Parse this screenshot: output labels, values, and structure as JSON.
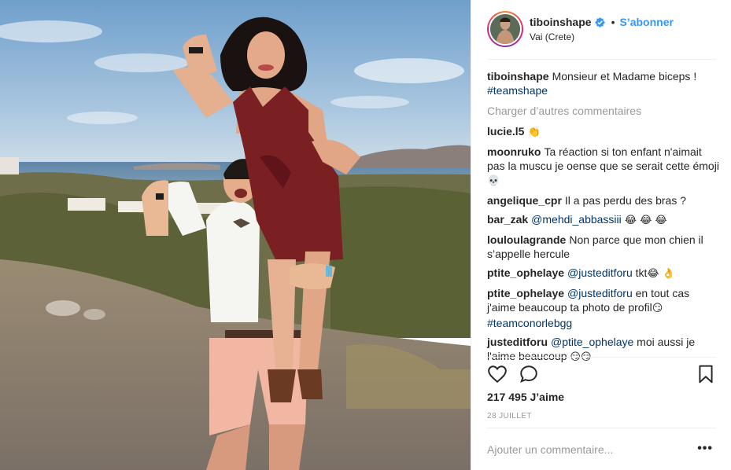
{
  "header": {
    "username": "tiboinshape",
    "follow_label": "S’abonner",
    "location": "Vai (Crete)"
  },
  "caption": {
    "user": "tiboinshape",
    "text": "Monsieur et Madame biceps !",
    "hashtag": "#teamshape"
  },
  "load_more": "Charger d’autres commentaires",
  "comments": [
    {
      "user": "lucie.l5",
      "parts": [
        {
          "t": "👏",
          "k": "emo"
        }
      ]
    },
    {
      "user": "moonruko",
      "parts": [
        {
          "t": "Ta réaction si ton enfant n'aimait pas la muscu je oense que se serait cette émoji ",
          "k": "txt"
        },
        {
          "t": "💀",
          "k": "emo"
        }
      ]
    },
    {
      "user": "angelique_cpr",
      "parts": [
        {
          "t": "Il a pas perdu des bras ?",
          "k": "txt"
        }
      ]
    },
    {
      "user": "bar_zak",
      "parts": [
        {
          "t": "@mehdi_abbassiii",
          "k": "tag"
        },
        {
          "t": " 😂 😂 😂",
          "k": "emo"
        }
      ]
    },
    {
      "user": "louloulagrande",
      "parts": [
        {
          "t": "Non parce que mon chien il s’appelle hercule",
          "k": "txt"
        }
      ]
    },
    {
      "user": "ptite_ophelaye",
      "parts": [
        {
          "t": "@justeditforu",
          "k": "tag"
        },
        {
          "t": " tkt",
          "k": "txt"
        },
        {
          "t": "😂 👌",
          "k": "emo"
        }
      ]
    },
    {
      "user": "ptite_ophelaye",
      "parts": [
        {
          "t": "@justeditforu",
          "k": "tag"
        },
        {
          "t": " en tout cas j'aime beaucoup ta photo de profil",
          "k": "txt"
        },
        {
          "t": "😏",
          "k": "emo"
        },
        {
          "t": " ",
          "k": "txt"
        },
        {
          "t": "#teamconorlebgg",
          "k": "tag"
        }
      ]
    },
    {
      "user": "justeditforu",
      "parts": [
        {
          "t": "@ptite_ophelaye",
          "k": "tag"
        },
        {
          "t": " moi aussi je l'aime beaucoup ",
          "k": "txt"
        },
        {
          "t": "😏😏",
          "k": "emo"
        }
      ]
    }
  ],
  "likes": "217 495 J’aime",
  "date": "28 JUILLET",
  "add_comment": {
    "placeholder": "Ajouter un commentaire..."
  },
  "more_label": "•••",
  "colors": {
    "link": "#3897f0",
    "tag": "#003569",
    "muted": "#999999",
    "text": "#262626"
  },
  "icons": [
    "verified-badge-icon",
    "heart-icon",
    "comment-icon",
    "bookmark-icon",
    "more-options-icon"
  ]
}
